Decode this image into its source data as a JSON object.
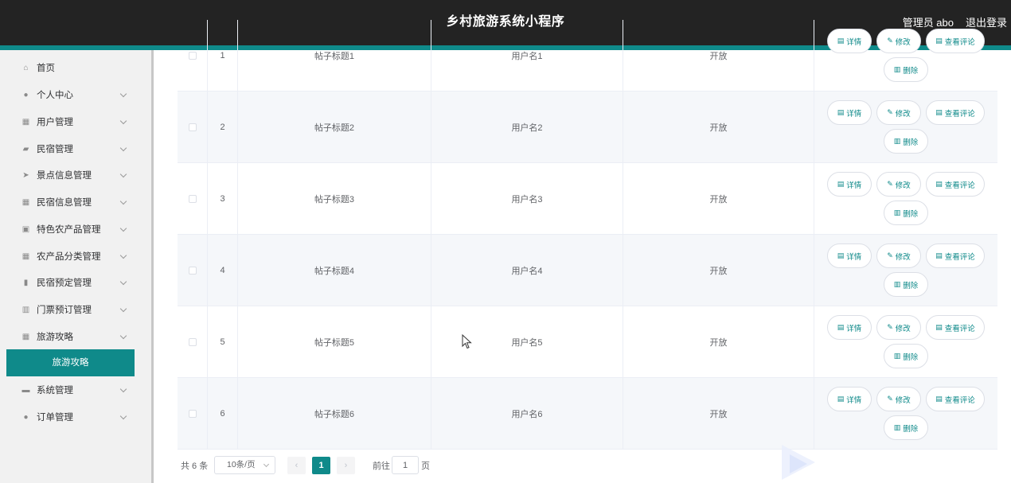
{
  "header": {
    "title": "乡村旅游系统小程序",
    "admin_label": "管理员 abo",
    "logout_label": "退出登录"
  },
  "colors": {
    "accent": "#0f8a8a",
    "header_bg": "#232323",
    "sidebar_bg": "#f1f1f1"
  },
  "sidebar": {
    "items": [
      {
        "label": "首页",
        "icon": "home-icon",
        "glyph": "⌂"
      },
      {
        "label": "个人中心",
        "icon": "user-icon",
        "glyph": "●"
      },
      {
        "label": "用户管理",
        "icon": "grid-icon",
        "glyph": "▦"
      },
      {
        "label": "民宿管理",
        "icon": "thumb-icon",
        "glyph": "▰"
      },
      {
        "label": "景点信息管理",
        "icon": "send-icon",
        "glyph": "➤"
      },
      {
        "label": "民宿信息管理",
        "icon": "grid-icon",
        "glyph": "▦"
      },
      {
        "label": "特色农产品管理",
        "icon": "clipboard-icon",
        "glyph": "▣"
      },
      {
        "label": "农产品分类管理",
        "icon": "grid-icon",
        "glyph": "▦"
      },
      {
        "label": "民宿预定管理",
        "icon": "bar-chart-icon",
        "glyph": "▮"
      },
      {
        "label": "门票预订管理",
        "icon": "library-icon",
        "glyph": "▥"
      },
      {
        "label": "旅游攻略",
        "icon": "grid-icon",
        "glyph": "▦"
      },
      {
        "label": "系统管理",
        "icon": "ticket-icon",
        "glyph": "▬"
      },
      {
        "label": "订单管理",
        "icon": "user-icon",
        "glyph": "●"
      }
    ],
    "active_sub": "旅游攻略"
  },
  "table": {
    "rows": [
      {
        "index": "1",
        "title": "帖子标题1",
        "user": "用户名1",
        "status": "开放"
      },
      {
        "index": "2",
        "title": "帖子标题2",
        "user": "用户名2",
        "status": "开放"
      },
      {
        "index": "3",
        "title": "帖子标题3",
        "user": "用户名3",
        "status": "开放"
      },
      {
        "index": "4",
        "title": "帖子标题4",
        "user": "用户名4",
        "status": "开放"
      },
      {
        "index": "5",
        "title": "帖子标题5",
        "user": "用户名5",
        "status": "开放"
      },
      {
        "index": "6",
        "title": "帖子标题6",
        "user": "用户名6",
        "status": "开放"
      }
    ],
    "actions": {
      "detail": "详情",
      "edit": "修改",
      "comments": "查看评论",
      "delete": "删除"
    }
  },
  "pagination": {
    "total": "共 6 条",
    "page_size": "10条/页",
    "current_page": "1",
    "goto_label": "前往",
    "goto_value": "1",
    "page_suffix": "页"
  }
}
